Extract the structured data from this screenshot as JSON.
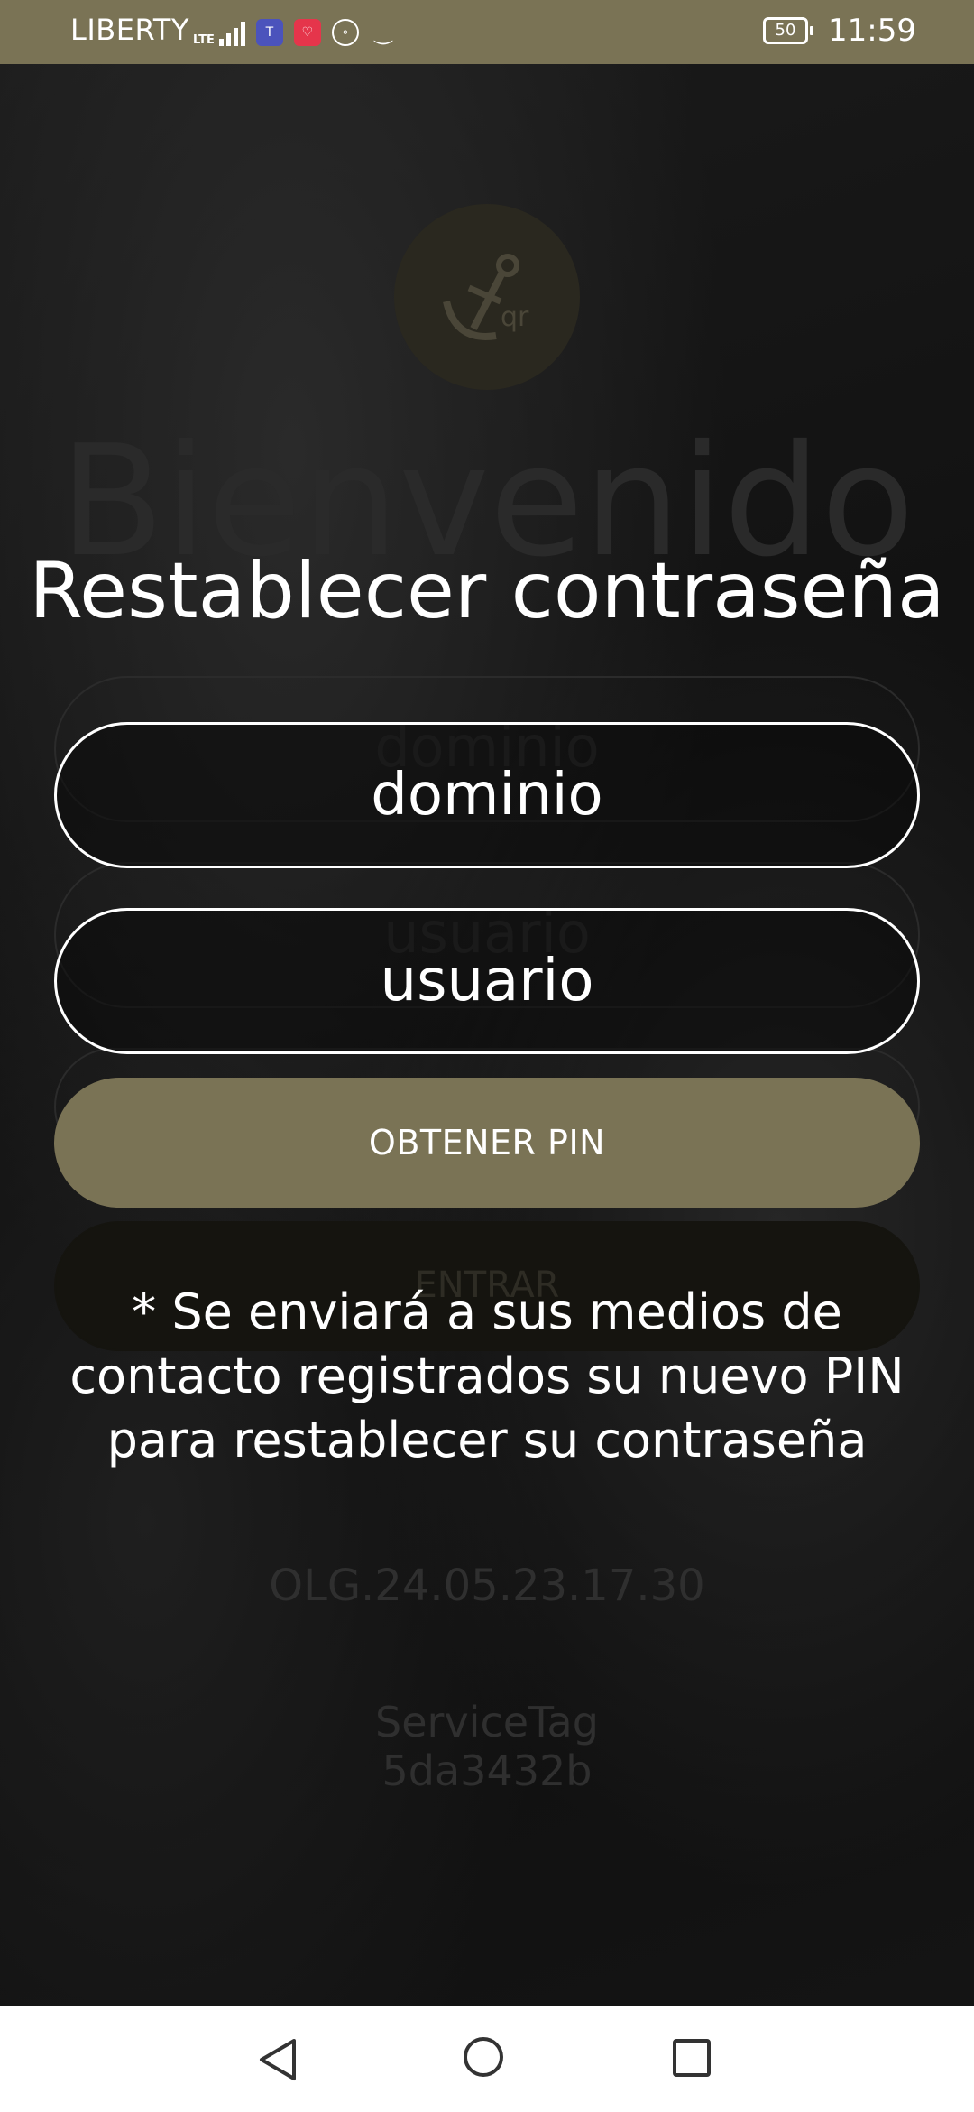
{
  "status_bar": {
    "carrier": "LIBERTY",
    "network": "LTE",
    "battery": "50",
    "time": "11:59"
  },
  "background": {
    "logo_text": "qr",
    "title": "Bienvenido",
    "domain_placeholder": "dominio",
    "user_placeholder": "usuario",
    "enter_label": "ENTRAR",
    "version": "OLG.24.05.23.17.30",
    "service_tag_label": "ServiceTag",
    "service_tag_value": "5da3432b"
  },
  "dialog": {
    "title": "Restablecer contraseña",
    "domain_placeholder": "dominio",
    "user_placeholder": "usuario",
    "button_label": "OBTENER PIN",
    "note": "* Se enviará a sus medios de contacto registrados su nuevo PIN para restablecer su contraseña"
  },
  "colors": {
    "accent": "#7a7355",
    "text": "#ffffff",
    "background": "#0b0b0b"
  },
  "icons": {
    "back": "back-triangle-icon",
    "home": "home-circle-icon",
    "recent": "recent-apps-square-icon"
  }
}
